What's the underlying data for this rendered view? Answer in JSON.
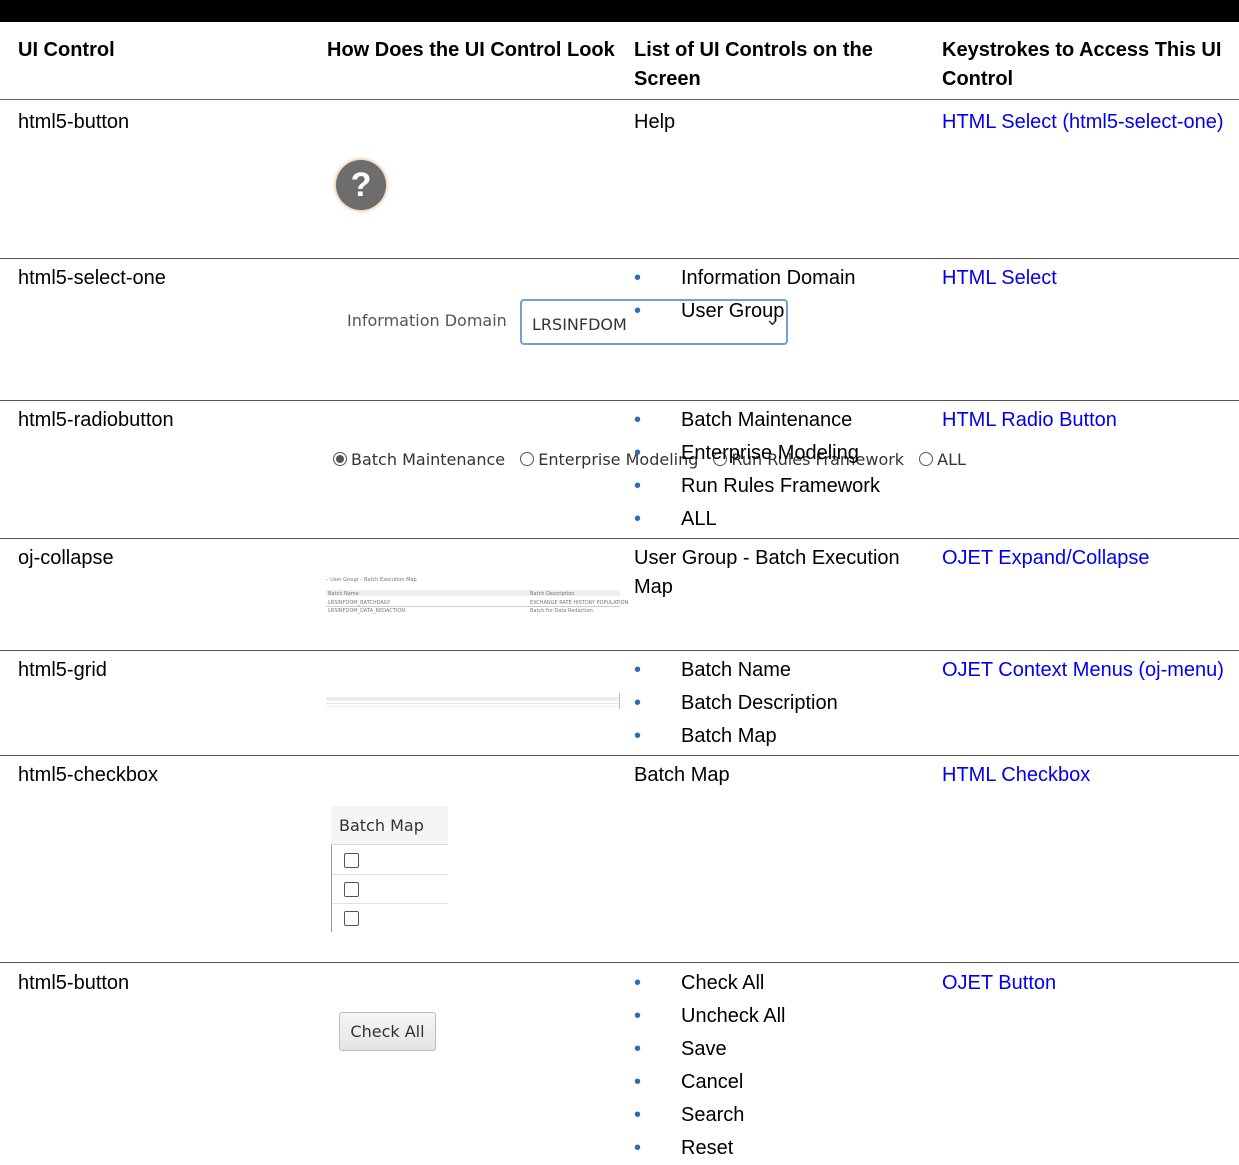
{
  "headers": [
    "UI Control",
    "How Does the UI Control Look",
    "List of UI Controls on the Screen",
    "Keystrokes to Access This UI Control"
  ],
  "rows": [
    {
      "control": "html5-button",
      "controls_text": "Help",
      "link": "HTML Select (html5-select-one)"
    },
    {
      "control": "html5-select-one",
      "bullets": [
        "Information Domain",
        "User Group"
      ],
      "link": "HTML Select",
      "visual": {
        "label": "Information Domain",
        "value": "LRSINFDOM"
      }
    },
    {
      "control": "html5-radiobutton",
      "bullets": [
        "Batch Maintenance",
        "Enterprise Modeling",
        "Run Rules Framework",
        "ALL"
      ],
      "link": "HTML Radio Button",
      "visual": {
        "options": [
          "Batch Maintenance",
          "Enterprise Modeling",
          "Run Rules Framework",
          "ALL"
        ],
        "selected": "Batch Maintenance"
      }
    },
    {
      "control": "oj-collapse",
      "controls_text": "User Group - Batch Execution Map",
      "link": "OJET Expand/Collapse",
      "visual": {
        "title": "– User Group – Batch Execution Map",
        "col1": "Batch Name",
        "col2": "Batch Description",
        "r1c1": "LRSINFDOM_BATCHDAILY",
        "r1c2": "EXCHANGE RATE HISTORY POPULATION",
        "r2c1": "LRSINFDOM_DATA_REDACTION",
        "r2c2": "Batch for Data Redaction"
      }
    },
    {
      "control": "html5-grid",
      "bullets": [
        "Batch Name",
        "Batch Description",
        "Batch Map"
      ],
      "link": "OJET Context Menus (oj-menu)"
    },
    {
      "control": "html5-checkbox",
      "controls_text": "Batch Map",
      "link": "HTML Checkbox",
      "visual": {
        "header": "Batch Map"
      }
    },
    {
      "control": "html5-button",
      "bullets": [
        "Check All",
        "Uncheck All",
        "Save",
        "Cancel",
        "Search",
        "Reset"
      ],
      "link": "OJET Button",
      "visual": {
        "button": "Check All"
      }
    }
  ],
  "icons": {
    "help": "help-question-icon",
    "select": "chevron-down-icon",
    "bullet": "•"
  },
  "colors": {
    "link": "#0000ee",
    "bullet": "#2a6db5",
    "select_border": "#6fa0d6"
  }
}
